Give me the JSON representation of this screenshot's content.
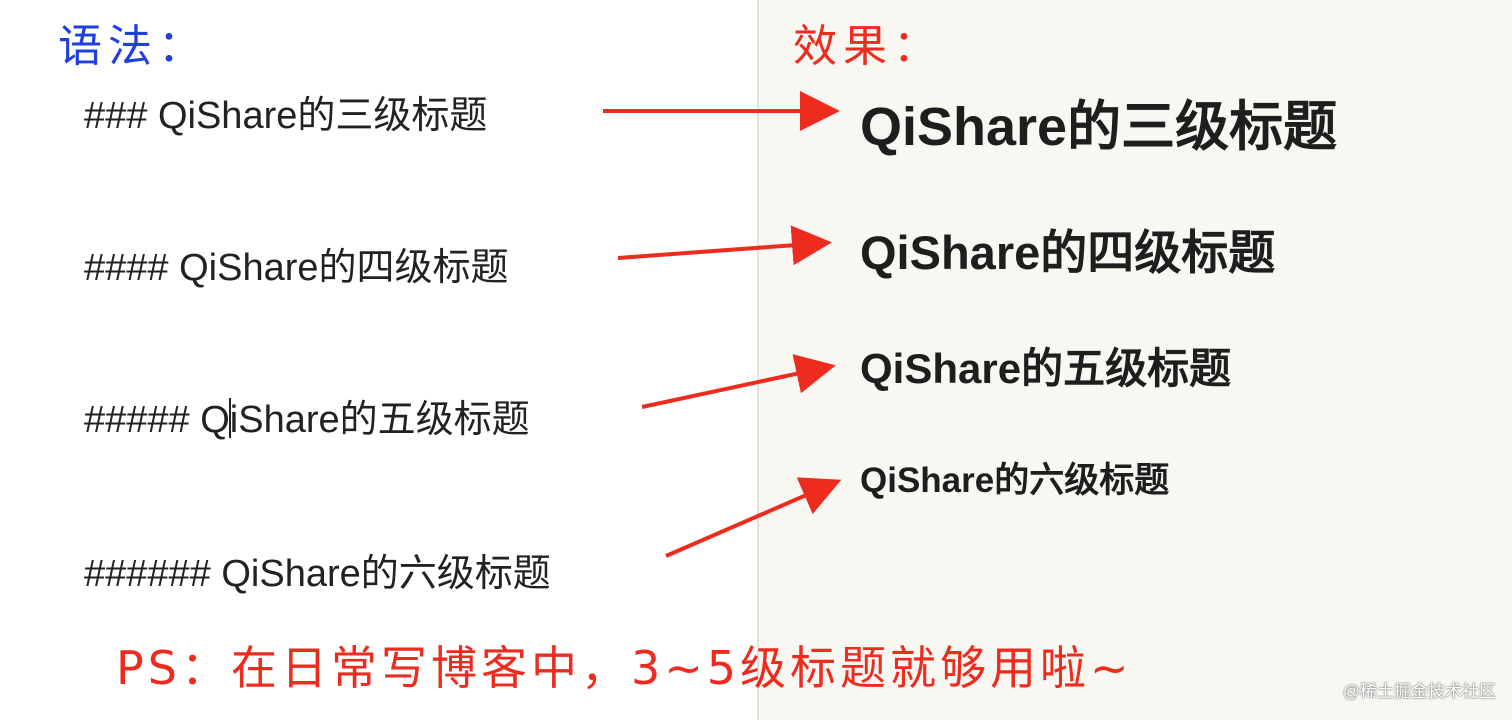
{
  "labels": {
    "syntax": "语法：",
    "effect": "效果："
  },
  "rows": [
    {
      "source": "### QiShare的三级标题",
      "rendered": "QiShare的三级标题"
    },
    {
      "source": "#### QiShare的四级标题",
      "rendered": "QiShare的四级标题"
    },
    {
      "source_before_caret": "##### Q",
      "source_after_caret": "iShare的五级标题",
      "rendered": "QiShare的五级标题"
    },
    {
      "source": "###### QiShare的六级标题",
      "rendered": "QiShare的六级标题"
    }
  ],
  "note": "PS：在日常写博客中，3~5级标题就够用啦~",
  "watermark": "@稀土掘金技术社区",
  "colors": {
    "syntax_label": "#1f3fe0",
    "annotation": "#ee2b1f",
    "right_pane_bg": "#f8f7f1"
  }
}
